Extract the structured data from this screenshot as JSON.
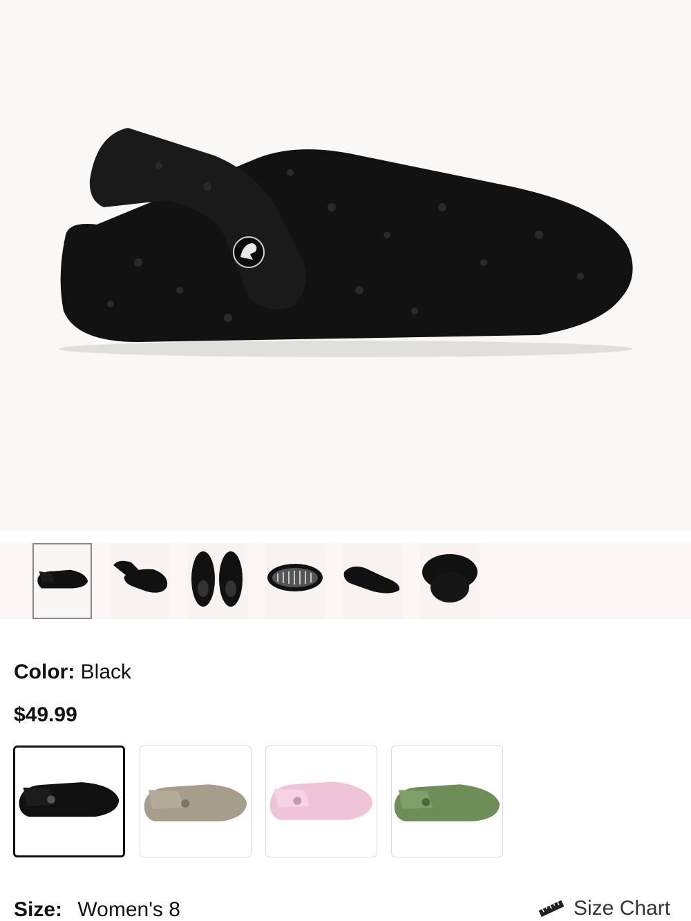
{
  "product": {
    "color_label": "Color:",
    "color_value": "Black",
    "price": "$49.99"
  },
  "thumbnails": [
    {
      "name": "side-view",
      "active": true
    },
    {
      "name": "pair-angle-view",
      "active": false
    },
    {
      "name": "top-view",
      "active": false
    },
    {
      "name": "sole-view",
      "active": false
    },
    {
      "name": "angle-view",
      "active": false
    },
    {
      "name": "back-view",
      "active": false
    }
  ],
  "swatches": [
    {
      "color_name": "Black",
      "hex": "#111111",
      "selected": true
    },
    {
      "color_name": "Mushroom",
      "hex": "#a69d8b",
      "selected": false
    },
    {
      "color_name": "Pink",
      "hex": "#efc4d8",
      "selected": false
    },
    {
      "color_name": "Green",
      "hex": "#6d8f57",
      "selected": false
    }
  ],
  "size": {
    "label": "Size:",
    "value": "Women's 8",
    "chart_label": "Size Chart"
  }
}
